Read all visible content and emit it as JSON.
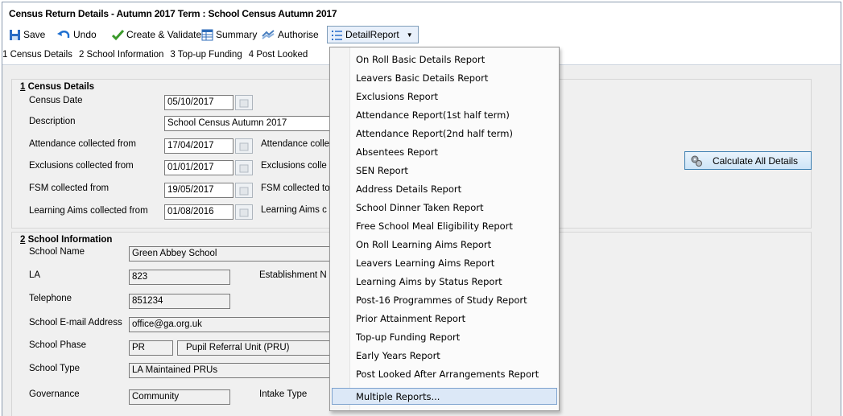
{
  "window": {
    "title": "Census Return Details - Autumn 2017 Term : School Census Autumn 2017"
  },
  "toolbar": {
    "save": "Save",
    "undo": "Undo",
    "create_validate": "Create & Validate",
    "summary": "Summary",
    "authorise": "Authorise",
    "detail_report": "DetailReport"
  },
  "tabs": [
    "1 Census Details",
    "2 School Information",
    "3 Top-up Funding",
    "4 Post Looked"
  ],
  "census_details": {
    "title_num": "1",
    "title_text": " Census Details",
    "census_date_label": "Census Date",
    "census_date": "05/10/2017",
    "description_label": "Description",
    "description": "School Census Autumn 2017",
    "attendance_from_label": "Attendance collected from",
    "attendance_from": "17/04/2017",
    "attendance_to_label": "Attendance colle",
    "exclusions_from_label": "Exclusions collected from",
    "exclusions_from": "01/01/2017",
    "exclusions_to_label": "Exclusions colle",
    "fsm_from_label": "FSM collected from",
    "fsm_from": "19/05/2017",
    "fsm_to_label": "FSM collected to",
    "learning_aims_from_label": "Learning Aims collected from",
    "learning_aims_from": "01/08/2016",
    "learning_aims_to_label": "Learning Aims c"
  },
  "calculate_button": "Calculate All Details",
  "school_info": {
    "title_num": "2",
    "title_text": " School Information",
    "school_name_label": "School Name",
    "school_name": "Green Abbey School",
    "la_label": "LA",
    "la": "823",
    "establishment_label": "Establishment N",
    "telephone_label": "Telephone",
    "telephone": "851234",
    "email_label": "School E-mail Address",
    "email": "office@ga.org.uk",
    "phase_label": "School Phase",
    "phase_code": "PR",
    "phase_desc": "Pupil Referral Unit (PRU)",
    "type_label": "School Type",
    "type": "LA Maintained PRUs",
    "governance_label": "Governance",
    "governance": "Community",
    "intake_label": "Intake Type"
  },
  "detail_report_menu": [
    "On Roll Basic Details Report",
    "Leavers Basic Details Report",
    "Exclusions Report",
    "Attendance Report(1st half term)",
    "Attendance Report(2nd half term)",
    "Absentees Report",
    "SEN Report",
    "Address Details Report",
    "School Dinner Taken Report",
    "Free School Meal Eligibility Report",
    "On Roll Learning Aims Report",
    "Leavers Learning Aims Report",
    "Learning Aims by Status Report",
    "Post-16 Programmes of Study Report",
    "Prior Attainment Report",
    "Top-up Funding Report",
    "Early Years Report",
    "Post Looked After Arrangements Report",
    "Multiple Reports..."
  ],
  "highlighted_menu_item": "Multiple Reports...",
  "colors": {
    "accent": "#3c7fb1",
    "menu_highlight": "#dce8f7",
    "panel": "#f0f0f0"
  }
}
